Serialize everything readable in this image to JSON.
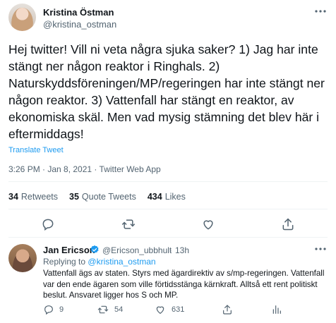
{
  "tweet": {
    "author_name": "Kristina Östman",
    "author_handle": "@kristina_ostman",
    "text": "Hej twitter! Vill ni veta några sjuka saker? 1) Jag har inte stängt ner någon reaktor i Ringhals. 2) Naturskyddsföreningen/MP/regeringen har inte stängt ner någon reaktor. 3) Vattenfall har stängt en reaktor, av ekonomiska skäl. Men vad mysig stämning det blev här i eftermiddags!",
    "translate_label": "Translate Tweet",
    "timestamp": "3:26 PM · Jan 8, 2021 · Twitter Web App",
    "stats": {
      "retweets_count": "34",
      "retweets_label": "Retweets",
      "quotes_count": "35",
      "quotes_label": "Quote Tweets",
      "likes_count": "434",
      "likes_label": "Likes"
    }
  },
  "reply": {
    "author_name": "Jan Ericson",
    "author_handle": "@Ericson_ubbhult",
    "separator": "·",
    "time": "13h",
    "replying_prefix": "Replying to",
    "replying_to": "@kristina_ostman",
    "text": "Vattenfall ägs av staten. Styrs med ägardirektiv av s/mp-regeringen. Vattenfall var den ende ägaren som ville förtidsstänga kärnkraft. Alltså ett rent politiskt beslut. Ansvaret ligger hos S och MP.",
    "reply_count": "9",
    "retweet_count": "54",
    "like_count": "631"
  },
  "colors": {
    "accent": "#1d9bf0",
    "secondary_text": "#536471",
    "divider": "#eff3f4"
  },
  "icons": [
    "more-icon",
    "reply-icon",
    "retweet-icon",
    "like-icon",
    "share-icon",
    "analytics-icon",
    "verified-icon"
  ]
}
